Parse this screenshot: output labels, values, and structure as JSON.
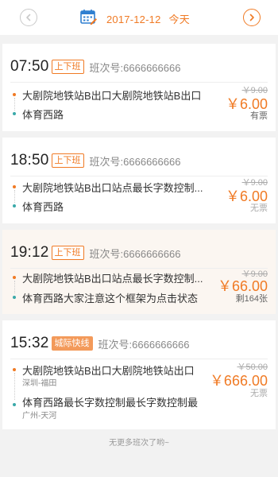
{
  "header": {
    "date": "2017-12-12",
    "day_label": "今天",
    "accent_color": "#f07a24",
    "prev_icon": "chevron-left-icon",
    "next_icon": "chevron-right-icon",
    "calendar_icon": "calendar-icon"
  },
  "trips": [
    {
      "time": "07:50",
      "tag": "上下班",
      "bus_no": "班次号:6666666666",
      "from": "大剧院地铁站B出口大剧院地铁站B出口",
      "to": "体育西路",
      "old_price": "￥9.00",
      "price": "￥6.00",
      "stock": "有票"
    },
    {
      "time": "18:50",
      "tag": "上下班",
      "bus_no": "班次号:6666666666",
      "from": "大剧院地铁站B出口站点最长字数控制...",
      "to": "体育西路",
      "old_price": "￥9.00",
      "price": "￥6.00",
      "stock": "无票"
    },
    {
      "time": "19:12",
      "tag": "上下班",
      "bus_no": "班次号:6666666666",
      "from": "大剧院地铁站B出口站点最长字数控制...",
      "to": "体育西路大家注意这个框架为点击状态",
      "old_price": "￥9.00",
      "price": "￥66.00",
      "stock": "剩164张"
    },
    {
      "time": "15:32",
      "tag": "城际快线",
      "bus_no": "班次号:6666666666",
      "from": "大剧院地铁站B出口大剧院地铁站出口",
      "from_sub": "深圳-福田",
      "to": "体育西路最长字数控制最长字数控制最",
      "to_sub": "广州-天河",
      "old_price": "￥50.00",
      "price": "￥666.00",
      "stock": "无票"
    }
  ],
  "footer": "无更多班次了哟~"
}
